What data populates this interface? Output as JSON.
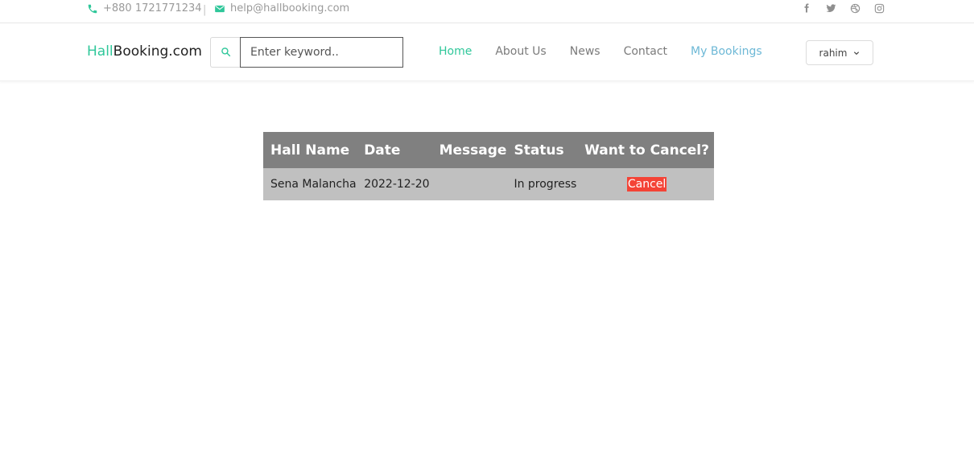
{
  "topbar": {
    "phone": "+880 1721771234",
    "separator": "|",
    "email": "help@hallbooking.com",
    "social": [
      "facebook-icon",
      "twitter-icon",
      "dribbble-icon",
      "instagram-icon"
    ]
  },
  "header": {
    "logo_accent": "Hall",
    "logo_rest": "Booking.com",
    "search_placeholder": "Enter keyword..",
    "nav": [
      {
        "label": "Home",
        "active": true
      },
      {
        "label": "About Us"
      },
      {
        "label": "News"
      },
      {
        "label": "Contact"
      },
      {
        "label": "My Bookings"
      }
    ],
    "user": "rahim"
  },
  "table": {
    "headers": [
      "Hall Name",
      "Date",
      "Message",
      "Status",
      "Want to Cancel?"
    ],
    "rows": [
      {
        "hall": "Sena Malancha",
        "date": "2022-12-20",
        "message": "",
        "status": "In progress",
        "action": "Cancel"
      }
    ]
  },
  "colors": {
    "accent": "#2fc79a",
    "my_bookings": "#6db8d6",
    "header_bg": "#808080",
    "row_bg": "#c0c0c0",
    "cancel": "#f44336"
  }
}
